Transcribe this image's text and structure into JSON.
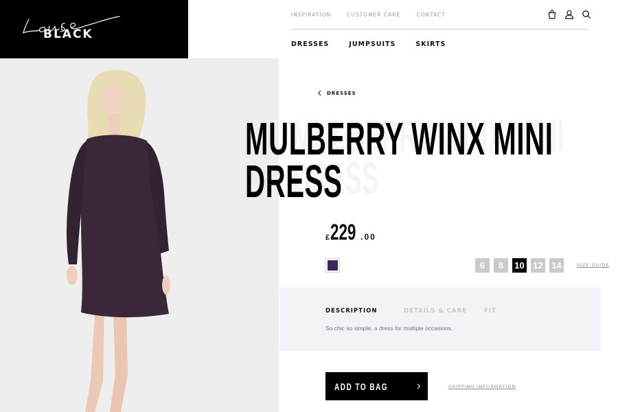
{
  "brand": {
    "script": "Louise",
    "wordmark": "BLACK"
  },
  "topnav": {
    "items": [
      "INSPIRATION",
      "CUSTOMER CARE",
      "CONTACT"
    ]
  },
  "icons": [
    "bag-icon",
    "account-icon",
    "search-icon"
  ],
  "catnav": {
    "items": [
      "DRESSES",
      "JUMPSUITS",
      "SKIRTS"
    ]
  },
  "breadcrumb": {
    "label": "DRESSES"
  },
  "product": {
    "title_line1": "MULBERRY WINX MINI",
    "title_line2": "DRESS",
    "ghost_line1": "MULBERRY WINX MINI",
    "ghost_line2": "DRESS",
    "price_currency": "£",
    "price_int": "229",
    "price_dec": ".00",
    "color_swatch": "#3b2a5e"
  },
  "sizes": {
    "options": [
      "6",
      "8",
      "10",
      "12",
      "14"
    ],
    "selected": "10",
    "guide_label": "SIZE GUIDE"
  },
  "details": {
    "tabs": [
      "DESCRIPTION",
      "DETAILS & CARE",
      "FIT"
    ],
    "active_tab": "DESCRIPTION",
    "description": "So chic so simple, a dress for multiple occasions."
  },
  "actions": {
    "add_to_bag": "ADD TO BAG",
    "shipping": "SHIPPING INFORMATION"
  },
  "colors": {
    "accent": "#000000",
    "panel": "#f1f3f6",
    "dress": "#3a2838"
  }
}
